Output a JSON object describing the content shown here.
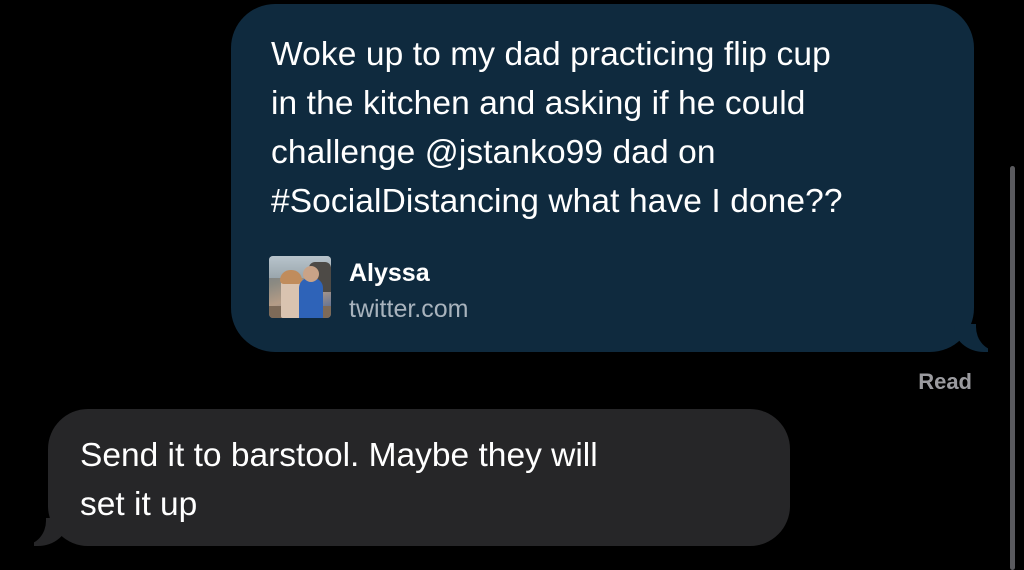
{
  "conversation": {
    "outgoing_link_preview": {
      "text": "Woke up to my dad practicing flip cup\nin the kitchen and asking if he could\nchallenge @jstanko99 dad on\n#SocialDistancing what have I done??",
      "author_name": "Alyssa",
      "domain": "twitter.com",
      "bubble_color": "#0f2a3e"
    },
    "read_receipt": "Read",
    "incoming_message": {
      "text": "Send it to barstool.  Maybe they will\nset it up",
      "bubble_color": "#262628"
    }
  }
}
